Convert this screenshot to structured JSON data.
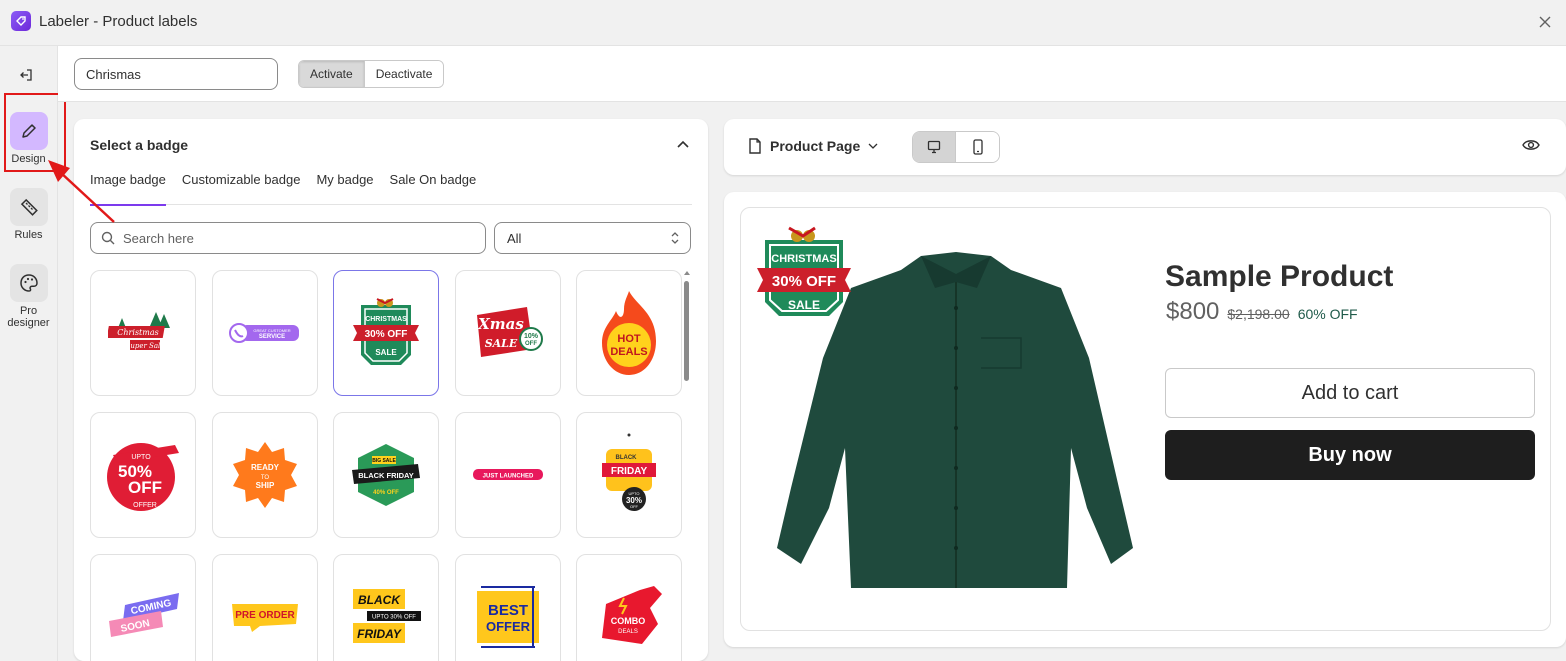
{
  "window": {
    "title": "Labeler - Product labels",
    "close_icon": "close-icon"
  },
  "nav": {
    "items": [
      {
        "label": "Design",
        "icon": "pencil-icon"
      },
      {
        "label": "Rules",
        "icon": "ruler-icon"
      },
      {
        "label": "Pro designer",
        "icon": "palette-icon"
      }
    ]
  },
  "topbar": {
    "label_name_value": "Chrismas",
    "activate_label": "Activate",
    "deactivate_label": "Deactivate"
  },
  "badge_panel": {
    "title": "Select a badge",
    "tabs": [
      "Image badge",
      "Customizable badge",
      "My badge",
      "Sale On badge"
    ],
    "search_placeholder": "Search here",
    "filter_value": "All",
    "badges": [
      {
        "name": "christmas-super-sale",
        "texts": [
          "Christmas",
          "Super Sale"
        ]
      },
      {
        "name": "great-customer-service",
        "texts": [
          "GREAT CUSTOMER",
          "SERVICE"
        ]
      },
      {
        "name": "christmas-30-off-sale",
        "texts": [
          "CHRISTMAS",
          "30% OFF",
          "SALE"
        ]
      },
      {
        "name": "xmas-sale-10-off",
        "texts": [
          "Xmas",
          "SALE",
          "10%",
          "OFF"
        ]
      },
      {
        "name": "hot-deals",
        "texts": [
          "HOT",
          "DEALS"
        ]
      },
      {
        "name": "upto-50-off-offer",
        "texts": [
          "UPTO",
          "50%",
          "OFF",
          "OFFER"
        ]
      },
      {
        "name": "ready-to-ship",
        "texts": [
          "READY",
          "TO",
          "SHIP"
        ]
      },
      {
        "name": "big-sale-black-friday-40-off",
        "texts": [
          "BIG SALE",
          "BLACK FRIDAY",
          "40% OFF"
        ]
      },
      {
        "name": "just-launched",
        "texts": [
          "JUST LAUNCHED"
        ]
      },
      {
        "name": "black-friday-upto-30-off",
        "texts": [
          "BLACK",
          "FRIDAY",
          "UPTO",
          "30%",
          "OFF"
        ]
      },
      {
        "name": "coming-soon",
        "texts": [
          "COMING",
          "SOON"
        ]
      },
      {
        "name": "pre-order",
        "texts": [
          "PRE ORDER"
        ]
      },
      {
        "name": "black-friday-upto-30-off-2",
        "texts": [
          "BLACK",
          "UPTO 30% OFF",
          "FRIDAY"
        ]
      },
      {
        "name": "best-offer",
        "texts": [
          "BEST",
          "OFFER"
        ]
      },
      {
        "name": "combo-deals",
        "texts": [
          "COMBO",
          "DEALS"
        ]
      }
    ],
    "selected_badge_index": 2
  },
  "preview": {
    "page_selector": "Product Page",
    "product_title": "Sample Product",
    "price": "$800",
    "compare_price": "$2,198.00",
    "discount": "60% OFF",
    "add_to_cart": "Add to cart",
    "buy_now": "Buy now",
    "badge_texts": [
      "CHRISTMAS",
      "30% OFF",
      "SALE"
    ]
  },
  "colors": {
    "accent": "#7c3aed",
    "design_active": "#d3b8ff",
    "shirt": "#1f4a3d",
    "buy_button": "#1e1e1e",
    "annotation": "#e11919"
  }
}
